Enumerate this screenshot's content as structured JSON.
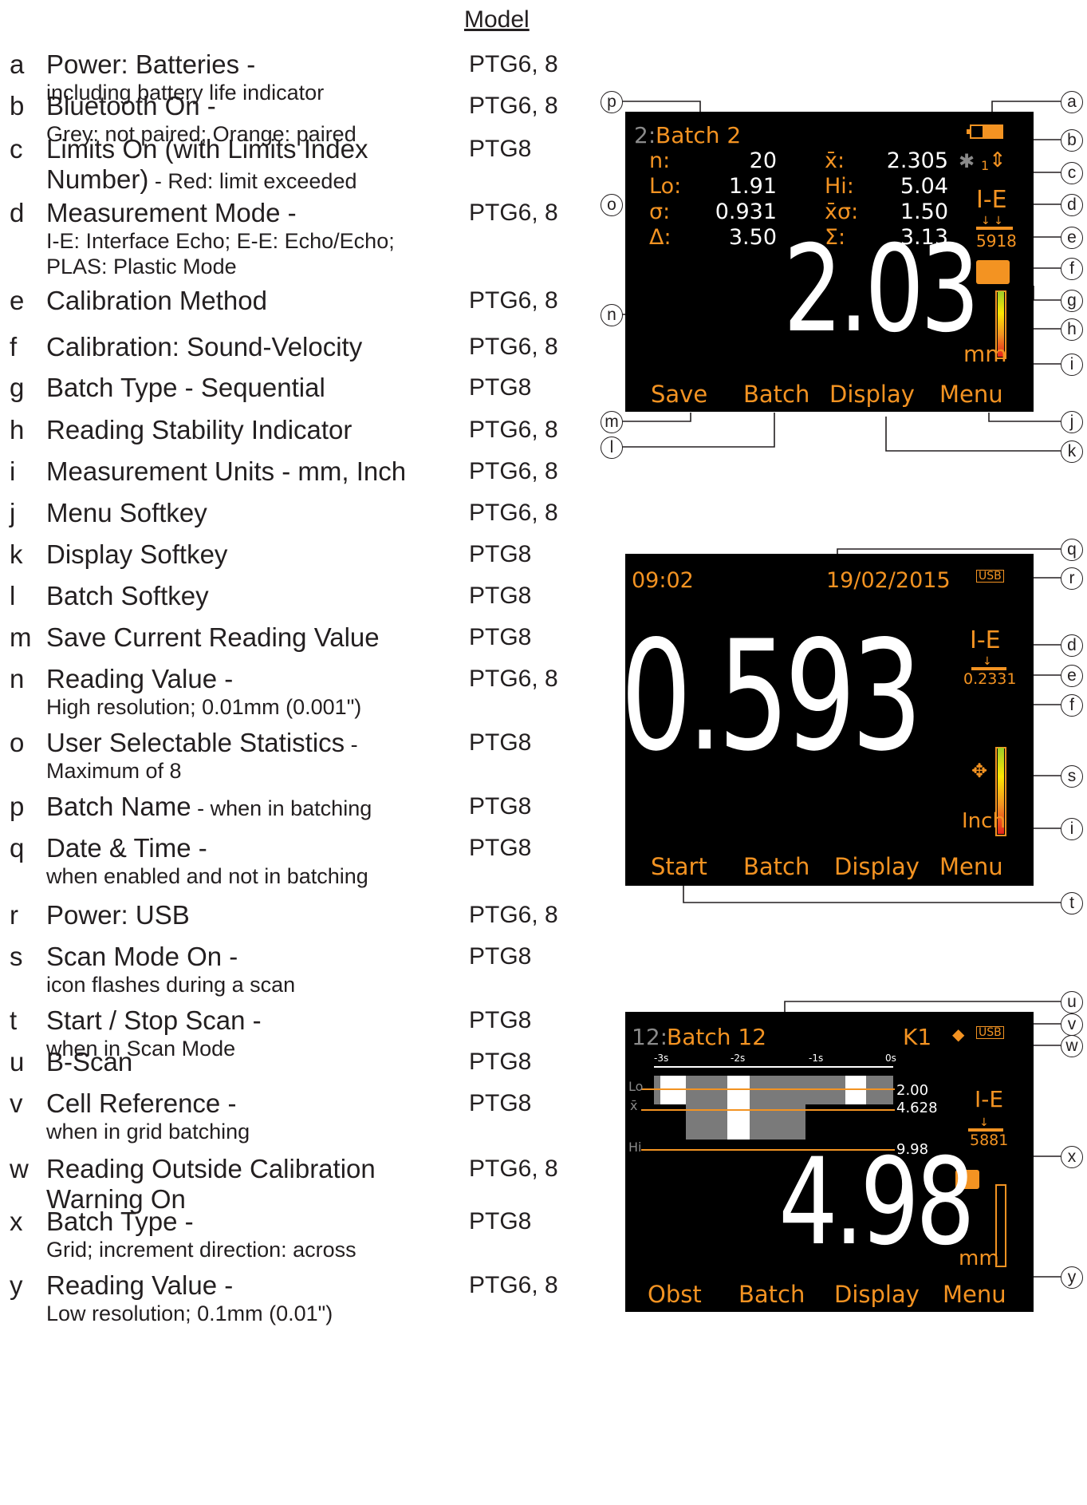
{
  "header": {
    "model": "Model"
  },
  "legend": [
    {
      "letter": "a",
      "title": "Power: Batteries -",
      "subtitle": "including battery life indicator",
      "model": "PTG6, 8"
    },
    {
      "letter": "b",
      "title": "Bluetooth On -",
      "subtitle": "Grey: not paired; Orange: paired",
      "model": "PTG6, 8"
    },
    {
      "letter": "c",
      "title": "Limits On (with Limits Index",
      "title2": "Number)",
      "title2_small": " - Red: limit exceeded",
      "model": "PTG8"
    },
    {
      "letter": "d",
      "title": "Measurement Mode -",
      "subtitle": "I-E: Interface Echo; E-E: Echo/Echo;",
      "subtitle2": "PLAS: Plastic Mode",
      "model": "PTG6, 8"
    },
    {
      "letter": "e",
      "title": "Calibration Method",
      "model": "PTG6, 8"
    },
    {
      "letter": "f",
      "title": "Calibration: Sound-Velocity",
      "model": "PTG6, 8"
    },
    {
      "letter": "g",
      "title": "Batch Type - Sequential",
      "model": "PTG8"
    },
    {
      "letter": "h",
      "title": "Reading Stability Indicator",
      "model": "PTG6, 8"
    },
    {
      "letter": "i",
      "title": "Measurement Units - mm, Inch",
      "model": "PTG6, 8"
    },
    {
      "letter": "j",
      "title": "Menu Softkey",
      "model": "PTG6, 8"
    },
    {
      "letter": "k",
      "title": "Display Softkey",
      "model": "PTG8"
    },
    {
      "letter": "l",
      "title": "Batch Softkey",
      "model": "PTG8"
    },
    {
      "letter": "m",
      "title": "Save Current Reading Value",
      "model": "PTG8"
    },
    {
      "letter": "n",
      "title": "Reading Value -",
      "subtitle": "High resolution; 0.01mm (0.001\")",
      "model": "PTG6, 8"
    },
    {
      "letter": "o",
      "title": "User Selectable Statistics",
      "title_small": " -",
      "subtitle": "Maximum of 8",
      "model": "PTG8"
    },
    {
      "letter": "p",
      "title": "Batch Name",
      "title_small": " - when in batching",
      "model": "PTG8"
    },
    {
      "letter": "q",
      "title": "Date & Time -",
      "subtitle": "when enabled and not in batching",
      "model": "PTG8"
    },
    {
      "letter": "r",
      "title": "Power: USB",
      "model": "PTG6, 8"
    },
    {
      "letter": "s",
      "title": "Scan Mode On -",
      "subtitle": "icon flashes during a scan",
      "model": "PTG8"
    },
    {
      "letter": "t",
      "title": "Start / Stop Scan -",
      "subtitle": "when in Scan Mode",
      "model": "PTG8"
    },
    {
      "letter": "u",
      "title": "B-Scan",
      "model": "PTG8"
    },
    {
      "letter": "v",
      "title": "Cell Reference -",
      "subtitle": "when in grid batching",
      "model": "PTG8"
    },
    {
      "letter": "w",
      "title": "Reading Outside Calibration",
      "title2": "Warning On",
      "model": "PTG6, 8"
    },
    {
      "letter": "x",
      "title": "Batch Type -",
      "subtitle": "Grid; increment direction: across",
      "model": "PTG8"
    },
    {
      "letter": "y",
      "title": "Reading Value -",
      "subtitle": "Low resolution; 0.1mm (0.01\")",
      "model": "PTG6, 8"
    }
  ],
  "screen1": {
    "batch_num": "2:",
    "batch_name": "Batch 2",
    "stats": [
      {
        "label": "n:",
        "value": "20",
        "label2": "x̄:",
        "value2": "2.305"
      },
      {
        "label": "Lo:",
        "value": "1.91",
        "label2": "Hi:",
        "value2": "5.04"
      },
      {
        "label": "σ:",
        "value": "0.931",
        "label2": "x̄σ:",
        "value2": "1.50"
      },
      {
        "label": "Δ:",
        "value": "3.50",
        "label2": "Σ:",
        "value2": "3.13"
      }
    ],
    "limits_index": "1",
    "mode": "I-E",
    "velocity": "5918",
    "reading": "2.03",
    "units": "mm",
    "softkeys": [
      "Save",
      "Batch",
      "Display",
      "Menu"
    ],
    "stability_level": 1.0
  },
  "screen2": {
    "time": "09:02",
    "date": "19/02/2015",
    "usb": "USB",
    "mode": "I-E",
    "velocity": "0.2331",
    "reading": "0.593",
    "units": "Inch",
    "softkeys": [
      "Start",
      "Batch",
      "Display",
      "Menu"
    ],
    "stability_level": 1.0
  },
  "screen3": {
    "batch_num": "12:",
    "batch_name": "Batch 12",
    "cell": "K1",
    "usb": "USB",
    "ticks": [
      "-3s",
      "-2s",
      "-1s",
      "0s"
    ],
    "lo_label": "Lo",
    "mean_label": "x̄",
    "hi_label": "Hi",
    "lo_value": "2.00",
    "mean_value": "4.628",
    "hi_value": "9.98",
    "mode": "I-E",
    "velocity": "5881",
    "reading": "4.98",
    "units": "mm",
    "softkeys": [
      "Obst",
      "Batch",
      "Display",
      "Menu"
    ],
    "stability_level": 0.0
  },
  "callouts": {
    "s1": [
      "p",
      "a",
      "b",
      "c",
      "d",
      "e",
      "f",
      "g",
      "h",
      "i",
      "j",
      "k",
      "l",
      "m",
      "n",
      "o"
    ],
    "s2": [
      "q",
      "r",
      "d",
      "e",
      "f",
      "s",
      "i",
      "t"
    ],
    "s3": [
      "u",
      "v",
      "w",
      "x",
      "y"
    ]
  },
  "colors": {
    "orange": "#f39322",
    "screen_bg": "#000000",
    "text": "#231f20"
  }
}
